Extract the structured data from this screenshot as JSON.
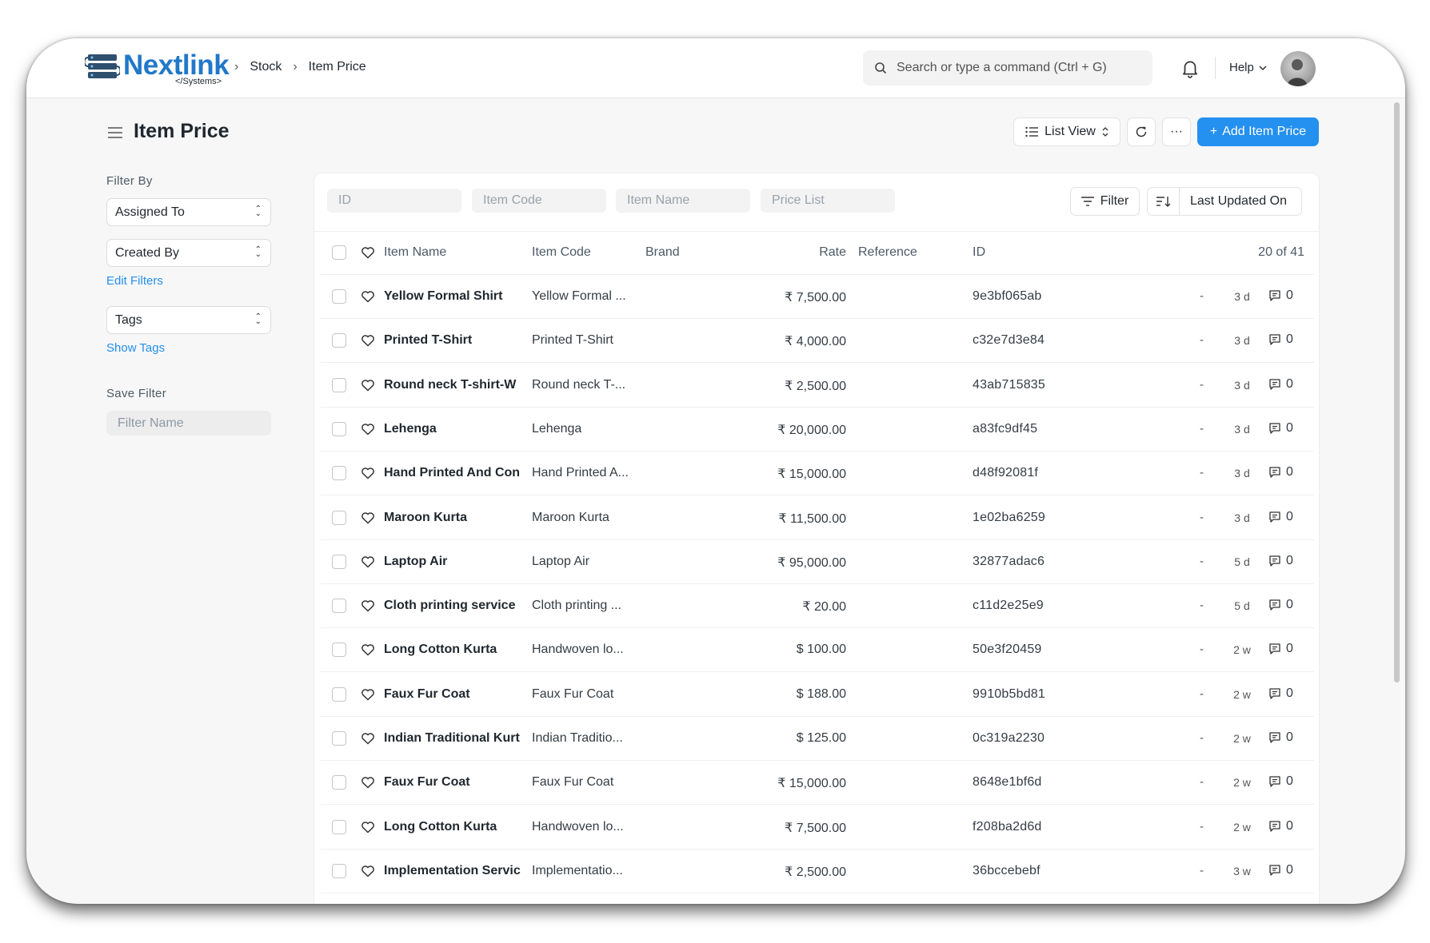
{
  "brand": {
    "name": "Nextlink",
    "sub": "</Systems>"
  },
  "breadcrumb": [
    "Stock",
    "Item Price"
  ],
  "search": {
    "placeholder": "Search or type a command (Ctrl + G)"
  },
  "help_label": "Help",
  "page_title": "Item Price",
  "toolbar": {
    "list_view": "List View",
    "more": "···",
    "add": "Add Item Price"
  },
  "sidebar": {
    "filter_by": "Filter By",
    "assigned_to": "Assigned To",
    "created_by": "Created By",
    "edit_filters": "Edit Filters",
    "tags": "Tags",
    "show_tags": "Show Tags",
    "save_filter": "Save Filter",
    "filter_name_placeholder": "Filter Name"
  },
  "filters": {
    "id": "ID",
    "item_code": "Item Code",
    "item_name": "Item Name",
    "price_list": "Price List",
    "filter_btn": "Filter",
    "sort_label": "Last Updated On"
  },
  "table": {
    "headers": {
      "item_name": "Item Name",
      "item_code": "Item Code",
      "brand": "Brand",
      "rate": "Rate",
      "reference": "Reference",
      "id": "ID",
      "count": "20 of 41"
    },
    "rows": [
      {
        "name": "Yellow Formal Shirt",
        "code": "Yellow Formal ...",
        "rate": "₹ 7,500.00",
        "id": "9e3bf065ab",
        "dash": "-",
        "age": "3 d",
        "comments": "0"
      },
      {
        "name": "Printed T-Shirt",
        "code": "Printed T-Shirt",
        "rate": "₹ 4,000.00",
        "id": "c32e7d3e84",
        "dash": "-",
        "age": "3 d",
        "comments": "0"
      },
      {
        "name": "Round neck T-shirt-W",
        "code": "Round neck T-...",
        "rate": "₹ 2,500.00",
        "id": "43ab715835",
        "dash": "-",
        "age": "3 d",
        "comments": "0"
      },
      {
        "name": "Lehenga",
        "code": "Lehenga",
        "rate": "₹ 20,000.00",
        "id": "a83fc9df45",
        "dash": "-",
        "age": "3 d",
        "comments": "0"
      },
      {
        "name": "Hand Printed And Con",
        "code": "Hand Printed A...",
        "rate": "₹ 15,000.00",
        "id": "d48f92081f",
        "dash": "-",
        "age": "3 d",
        "comments": "0"
      },
      {
        "name": "Maroon Kurta",
        "code": "Maroon Kurta",
        "rate": "₹ 11,500.00",
        "id": "1e02ba6259",
        "dash": "-",
        "age": "3 d",
        "comments": "0"
      },
      {
        "name": "Laptop Air",
        "code": "Laptop Air",
        "rate": "₹ 95,000.00",
        "id": "32877adac6",
        "dash": "-",
        "age": "5 d",
        "comments": "0"
      },
      {
        "name": "Cloth printing service",
        "code": "Cloth printing ...",
        "rate": "₹ 20.00",
        "id": "c11d2e25e9",
        "dash": "-",
        "age": "5 d",
        "comments": "0"
      },
      {
        "name": "Long Cotton Kurta",
        "code": "Handwoven lo...",
        "rate": "$ 100.00",
        "id": "50e3f20459",
        "dash": "-",
        "age": "2 w",
        "comments": "0"
      },
      {
        "name": "Faux Fur Coat",
        "code": "Faux Fur Coat",
        "rate": "$ 188.00",
        "id": "9910b5bd81",
        "dash": "-",
        "age": "2 w",
        "comments": "0"
      },
      {
        "name": "Indian Traditional Kurt",
        "code": "Indian Traditio...",
        "rate": "$ 125.00",
        "id": "0c319a2230",
        "dash": "-",
        "age": "2 w",
        "comments": "0"
      },
      {
        "name": "Faux Fur Coat",
        "code": "Faux Fur Coat",
        "rate": "₹ 15,000.00",
        "id": "8648e1bf6d",
        "dash": "-",
        "age": "2 w",
        "comments": "0"
      },
      {
        "name": "Long Cotton Kurta",
        "code": "Handwoven lo...",
        "rate": "₹ 7,500.00",
        "id": "f208ba2d6d",
        "dash": "-",
        "age": "2 w",
        "comments": "0"
      },
      {
        "name": "Implementation Servic",
        "code": "Implementatio...",
        "rate": "₹ 2,500.00",
        "id": "36bccebebf",
        "dash": "-",
        "age": "3 w",
        "comments": "0"
      }
    ]
  },
  "colors": {
    "accent": "#2490ef",
    "brand": "#2278c8"
  }
}
